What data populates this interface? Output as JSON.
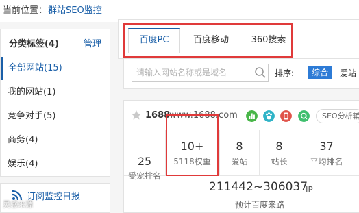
{
  "breadcrumb": {
    "label": "当前位置：",
    "link": "群站SEO监控"
  },
  "sidebar": {
    "title": "分类标签(4)",
    "manage": "管理",
    "items": [
      {
        "label": "全部网站(15)",
        "active": true
      },
      {
        "label": "我的网站(1)",
        "active": false
      },
      {
        "label": "竞争对手(5)",
        "active": false
      },
      {
        "label": "商务(4)",
        "active": false
      },
      {
        "label": "娱乐(4)",
        "active": false
      }
    ]
  },
  "subscribe": {
    "label": "订阅监控日报",
    "icon": "rss-icon"
  },
  "watermark": "灵感来源",
  "tabs": [
    {
      "label": "百度PC",
      "active": true
    },
    {
      "label": "百度移动",
      "active": false
    },
    {
      "label": "360搜索",
      "active": false
    }
  ],
  "search": {
    "placeholder": "请输入网站名称或是域名",
    "value": ""
  },
  "sort": {
    "label": "排序:",
    "options": [
      "综合",
      "爱站"
    ],
    "selected": "综合"
  },
  "site": {
    "name": "1688",
    "separator": "-",
    "url": "www.1688.com",
    "badges": [
      {
        "icon": "bar-chart-icon",
        "color": "#49b649"
      },
      {
        "icon": "paw-icon",
        "color": "#2fb3c7"
      },
      {
        "icon": "mobile-icon",
        "color": "#e0544b"
      },
      {
        "icon": "search-q-icon",
        "color": "#3fbf6e"
      }
    ],
    "seo_button": "SEO分析辅",
    "stats": [
      {
        "value": "25",
        "label": "受宠排名"
      },
      {
        "value": "10+",
        "label": "5118权重"
      },
      {
        "value": "8",
        "label": "爱站"
      },
      {
        "value": "8",
        "label": "站长"
      },
      {
        "value": "37",
        "label": "平均排名"
      }
    ],
    "ip_range": "211442~306037",
    "ip_unit": "IP",
    "ip_label": "预计百度来路"
  },
  "colors": {
    "accent": "#1a5fa8",
    "highlight_box": "#e03a3a",
    "sort_active": "#2d7bd6"
  }
}
